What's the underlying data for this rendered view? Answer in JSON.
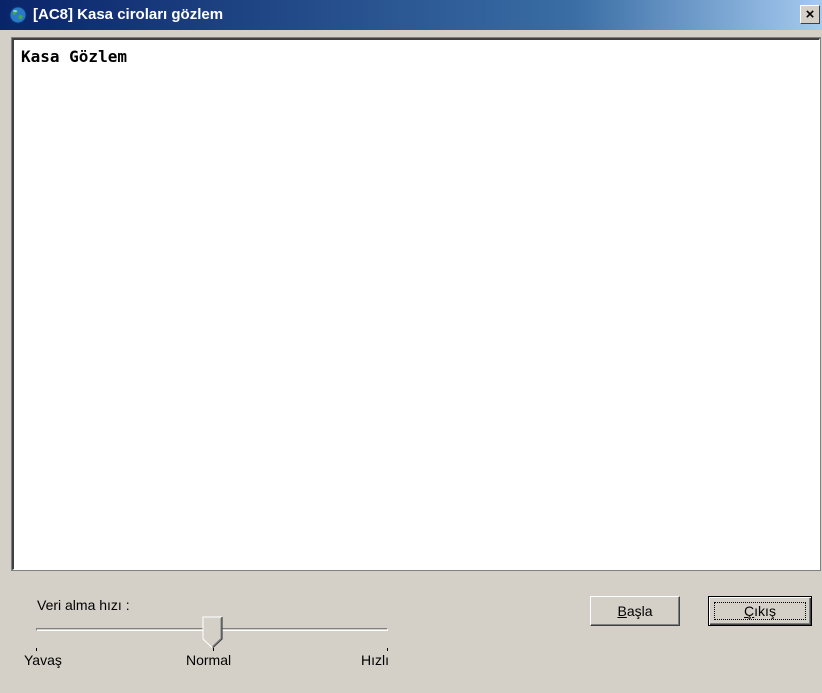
{
  "window": {
    "title": "[AC8] Kasa ciroları gözlem",
    "close_label": "×"
  },
  "log": {
    "text": "Kasa Gözlem"
  },
  "speed": {
    "label": "Veri alma hızı :",
    "value": 0.5,
    "ticks": [
      "Yavaş",
      "Normal",
      "Hızlı"
    ]
  },
  "buttons": {
    "start": {
      "mnemonic": "B",
      "rest": "aşla"
    },
    "exit": {
      "mnemonic": "Ç",
      "rest": "ıkış"
    }
  },
  "icons": {
    "app": "globe-icon",
    "close": "close-icon"
  },
  "colors": {
    "titlebar_start": "#0a246a",
    "titlebar_end": "#a6caf0",
    "face": "#d4d0c8"
  }
}
